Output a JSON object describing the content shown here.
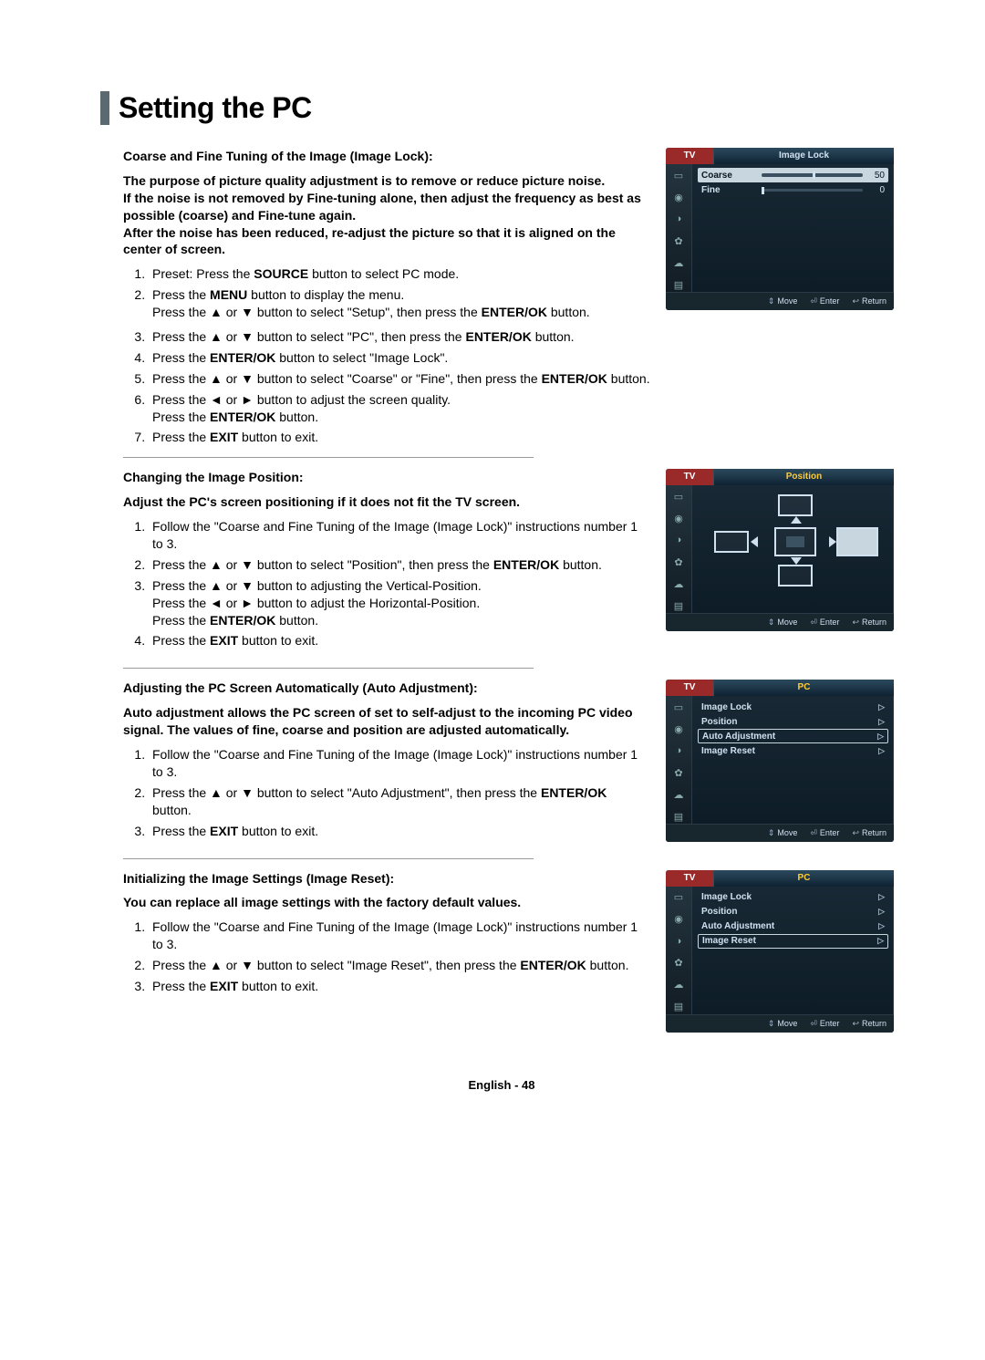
{
  "title": "Setting the PC",
  "page_number": "English - 48",
  "up": "▲",
  "down": "▼",
  "left": "◄",
  "right": "►",
  "sections": {
    "a": {
      "heading": "Coarse and Fine Tuning of the Image (Image Lock):",
      "intro": "The purpose of picture quality adjustment is to remove or reduce picture noise.\nIf the noise is not removed by Fine-tuning alone, then adjust the frequency as best as possible (coarse) and Fine-tune again.\nAfter the noise has been reduced, re-adjust the picture so that it is aligned on the center of screen.",
      "steps": [
        {
          "pre": "Preset: Press the ",
          "b1": "SOURCE",
          "post": " button to select PC mode."
        },
        {
          "pre": "Press the ",
          "b1": "MENU",
          "mid": " button to display the menu.\nPress the ▲ or ▼ button to select \"Setup\", then press the ",
          "b2": "ENTER/OK",
          "post": " button."
        },
        {
          "pre": "Press the ▲ or ▼ button to select \"PC\", then press the ",
          "b1": "ENTER/OK",
          "post": " button."
        },
        {
          "pre": "Press the ",
          "b1": "ENTER/OK",
          "post": " button to select \"Image Lock\"."
        },
        {
          "pre": "Press the  ▲ or ▼ button to select \"Coarse\" or \"Fine\", then press the ",
          "b1": "ENTER/OK",
          "post": " button."
        },
        {
          "pre": "Press the ◄ or ► button to adjust the screen quality.\nPress the ",
          "b1": "ENTER/OK",
          "post": " button."
        },
        {
          "pre": "Press the ",
          "b1": "EXIT",
          "post": " button to exit."
        }
      ]
    },
    "b": {
      "heading": "Changing the Image Position:",
      "intro": "Adjust the PC's screen positioning if it does not fit the TV screen.",
      "steps": [
        {
          "text": "Follow the \"Coarse and Fine Tuning of the Image (Image Lock)\"  instructions number 1 to 3."
        },
        {
          "pre": "Press the ▲ or ▼ button to select \"Position\", then press the ",
          "b1": "ENTER/OK",
          "post": " button."
        },
        {
          "pre": "Press the ▲ or ▼ button to adjusting the Vertical-Position.\nPress the ◄ or ► button to adjust the Horizontal-Position.\nPress the ",
          "b1": "ENTER/OK",
          "post": " button."
        },
        {
          "pre": "Press the ",
          "b1": "EXIT",
          "post": " button to exit."
        }
      ]
    },
    "c": {
      "heading": "Adjusting the PC Screen Automatically (Auto Adjustment):",
      "intro": "Auto adjustment allows the PC screen of set to self-adjust to the incoming PC video signal. The values of fine, coarse and position are adjusted automatically.",
      "steps": [
        {
          "text": "Follow the \"Coarse and Fine Tuning of the Image (Image Lock)\"  instructions number 1 to 3."
        },
        {
          "pre": "Press the ▲ or ▼ button to select \"Auto Adjustment\", then press the ",
          "b1": "ENTER/OK",
          "post": " button."
        },
        {
          "pre": "Press the ",
          "b1": "EXIT",
          "post": " button to exit."
        }
      ]
    },
    "d": {
      "heading": "Initializing the Image Settings (Image Reset):",
      "intro": "You can replace all image settings with the factory default values.",
      "steps": [
        {
          "text": "Follow the \"Coarse and Fine Tuning of the Image (Image Lock)\"  instructions number 1 to 3."
        },
        {
          "pre": "Press the ▲ or ▼ button to select \"Image Reset\", then press the ",
          "b1": "ENTER/OK",
          "post": " button."
        },
        {
          "pre": "Press the ",
          "b1": "EXIT",
          "post": " button to exit."
        }
      ]
    }
  },
  "osd": {
    "tv": "TV",
    "footer": {
      "move": "Move",
      "enter": "Enter",
      "return": "Return"
    },
    "icons": [
      "▭",
      "◉",
      "◑",
      "✿",
      "☁",
      "▤"
    ],
    "panels": {
      "image_lock": {
        "title": "Image Lock",
        "rows": [
          {
            "label": "Coarse",
            "value": "50",
            "sel": true
          },
          {
            "label": "Fine",
            "value": "0",
            "sel": false
          }
        ]
      },
      "position": {
        "title": "Position"
      },
      "pc1": {
        "title": "PC",
        "items": [
          {
            "label": "Image Lock",
            "sel": false
          },
          {
            "label": "Position",
            "sel": false
          },
          {
            "label": "Auto Adjustment",
            "sel": true
          },
          {
            "label": "Image Reset",
            "sel": false
          }
        ]
      },
      "pc2": {
        "title": "PC",
        "items": [
          {
            "label": "Image Lock",
            "sel": false
          },
          {
            "label": "Position",
            "sel": false
          },
          {
            "label": "Auto Adjustment",
            "sel": false
          },
          {
            "label": "Image Reset",
            "sel": true
          }
        ]
      }
    }
  }
}
